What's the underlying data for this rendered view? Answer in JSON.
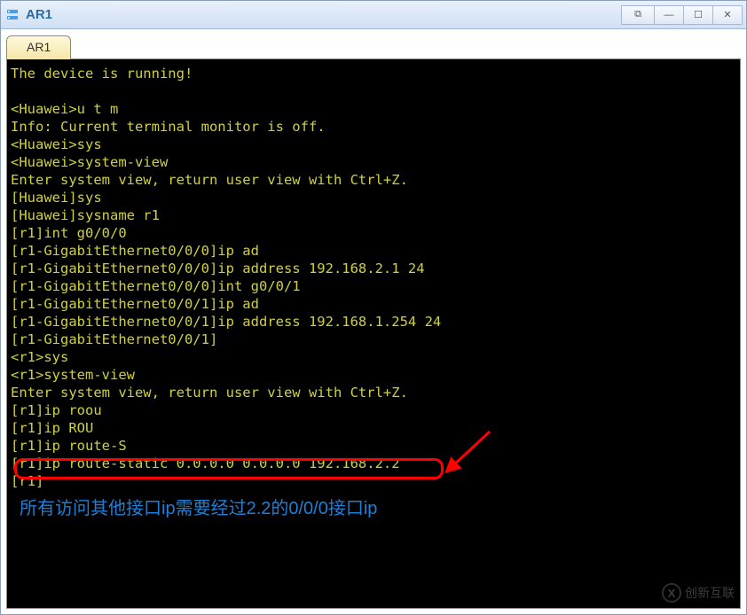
{
  "window": {
    "title": "AR1",
    "controls": {
      "extra": "⧉",
      "min": "—",
      "max": "☐",
      "close": "✕"
    }
  },
  "tab": {
    "label": "AR1"
  },
  "terminal": {
    "lines": [
      "The device is running!",
      "",
      "<Huawei>u t m",
      "Info: Current terminal monitor is off.",
      "<Huawei>sys",
      "<Huawei>system-view",
      "Enter system view, return user view with Ctrl+Z.",
      "[Huawei]sys",
      "[Huawei]sysname r1",
      "[r1]int g0/0/0",
      "[r1-GigabitEthernet0/0/0]ip ad",
      "[r1-GigabitEthernet0/0/0]ip address 192.168.2.1 24",
      "[r1-GigabitEthernet0/0/0]int g0/0/1",
      "[r1-GigabitEthernet0/0/1]ip ad",
      "[r1-GigabitEthernet0/0/1]ip address 192.168.1.254 24",
      "[r1-GigabitEthernet0/0/1]",
      "<r1>sys",
      "<r1>system-view",
      "Enter system view, return user view with Ctrl+Z.",
      "[r1]ip roou",
      "[r1]ip ROU",
      "[r1]ip route-S",
      "[r1]ip route-static 0.0.0.0 0.0.0.0 192.168.2.2",
      "[r1]"
    ]
  },
  "highlight": {
    "line_index": 22
  },
  "annotation": {
    "text": "所有访问其他接口ip需要经过2.2的0/0/0接口ip"
  },
  "watermark": {
    "logo_text": "X",
    "brand": "创新互联"
  }
}
